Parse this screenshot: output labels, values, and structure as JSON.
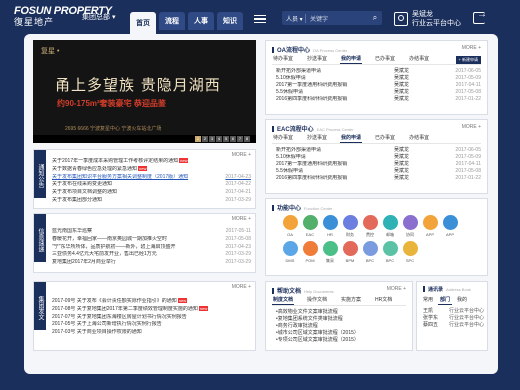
{
  "header": {
    "logo_en": "FOSUN PROPERTY",
    "logo_cn": "復星地产",
    "group_label": "集团总部 ▾",
    "nav_tabs": [
      "首页",
      "流程",
      "人事",
      "知识"
    ],
    "search": {
      "scope": "人员 ▾",
      "placeholder": "关键字"
    },
    "user": {
      "name": "吴斌龙",
      "role": "行业云平台中心"
    }
  },
  "banner": {
    "corner_text": "复星 •",
    "headline": "甬上多望族 贵隐月湖西",
    "subline": "约90-175m²奢装豪宅 恭迎品鉴",
    "footer": "2695 6666 宁波复星中心 宁波火车站北广场",
    "pages": [
      "1",
      "2",
      "3",
      "4",
      "5",
      "6",
      "7",
      "8"
    ]
  },
  "notices": {
    "tab": "通知公告",
    "more": "MORE +",
    "items": [
      {
        "t": "关于2017年一季度成本采购管理工作考核评定结果的通知",
        "d": "",
        "new": true,
        "link": false
      },
      {
        "t": "关于数据青春绿色应急处理的紧急通知",
        "d": "",
        "new": true,
        "link": false
      },
      {
        "t": "关于发布集团知识平台服务方案相关调整制度（2017版）通知",
        "d": "2017-04-23",
        "new": false,
        "link": true
      },
      {
        "t": "关于发布在线采购变更通知",
        "d": "2017-04-22",
        "new": false,
        "link": false
      },
      {
        "t": "关于发布项目文档调整的通知",
        "d": "2017-04-21",
        "new": false,
        "link": false
      },
      {
        "t": "关于发布集团部分通知",
        "d": "2017-03-29",
        "new": false,
        "link": false
      }
    ]
  },
  "info": {
    "tab": "信息速递",
    "more": "MORE +",
    "items": [
      {
        "t": "蓝光南国东华巡察",
        "d": "2017-05-11"
      },
      {
        "t": "春暖花开，幸福回家——南京奥园城一期加推火空时",
        "d": "2017-05-08"
      },
      {
        "t": "\"宁\"东华所所体，品质护航初——新外，碧上海启顶盛开",
        "d": "2017-04-23"
      },
      {
        "t": "三亚债务4.4亿元大宅前发开业，售出已经1万元",
        "d": "2017-03-29"
      },
      {
        "t": "复地集团2017年2月商业举行",
        "d": "2017-03-29"
      }
    ]
  },
  "circulars": {
    "tab": "集团发文",
    "more": "MORE +",
    "items": [
      {
        "t": "2017-09号 关于发布《会计责任额实际作业指引》的通知",
        "new": true
      },
      {
        "t": "2017-08号 关于复地集团2017年第二季度绩效管理制度实施的通知",
        "new": true
      },
      {
        "t": "2017-07号 关于复地集团东海楼区房屋计划书行情况实例报告",
        "new": false
      },
      {
        "t": "2017-05号 关于上海公司新增执行情况实例行报告",
        "new": false
      },
      {
        "t": "2017-03号 关于商业项目操作权限的通知",
        "new": false
      }
    ]
  },
  "oa": {
    "title": "OA流程中心",
    "subtitle": "OA Process Center",
    "more": "MORE +",
    "tabs": [
      "待办事宜",
      "抄送事宜",
      "我的申请",
      "已办事宜",
      "办结事宜"
    ],
    "active_tab": 2,
    "new_button": "+ 新建申请",
    "rows": [
      {
        "t": "新开拓外部渠道申请",
        "p": "吴斌龙",
        "d": "2017-06-05"
      },
      {
        "t": "5.10休假申请",
        "p": "吴斌龙",
        "d": "2017-05-09"
      },
      {
        "t": "2017第一季度通用科研费用报销",
        "p": "吴斌龙",
        "d": "2017-04-11"
      },
      {
        "t": "5.5休假申请",
        "p": "吴斌龙",
        "d": "2017-05-08"
      },
      {
        "t": "2016第四季度科研科研费用报销",
        "p": "吴斌龙",
        "d": "2017-01-22"
      }
    ]
  },
  "eac": {
    "title": "EAC流程中心",
    "subtitle": "EAC Process Center",
    "more": "MORE +",
    "tabs": [
      "待办事宜",
      "抄送事宜",
      "我的申请",
      "已办事宜",
      "办结事宜"
    ],
    "active_tab": 2,
    "rows": [
      {
        "t": "新开拓外部渠道申请",
        "p": "吴斌龙",
        "d": "2017-06-05"
      },
      {
        "t": "5.10休假申请",
        "p": "吴斌龙",
        "d": "2017-05-09"
      },
      {
        "t": "2017第一季度通用科研费用报销",
        "p": "吴斌龙",
        "d": "2017-04-11"
      },
      {
        "t": "5.5休假申请",
        "p": "吴斌龙",
        "d": "2017-05-08"
      },
      {
        "t": "2016第四季度科研科研费用报销",
        "p": "吴斌龙",
        "d": "2017-01-22"
      }
    ]
  },
  "functions": {
    "title": "功能中心",
    "subtitle": "Function Center",
    "items": [
      {
        "label": "OA",
        "color": "#f2a33a"
      },
      {
        "label": "EAC",
        "color": "#52b06b"
      },
      {
        "label": "HR",
        "color": "#3a8fd6"
      },
      {
        "label": "财务",
        "color": "#6c7ee0"
      },
      {
        "label": "费控",
        "color": "#e36a5a"
      },
      {
        "label": "邮箱",
        "color": "#2fb2b6"
      },
      {
        "label": "协同",
        "color": "#8a6fcf"
      },
      {
        "label": "APP",
        "color": "#f2a33a"
      },
      {
        "label": "APP",
        "color": "#3a8fd6"
      },
      {
        "label": "DMS",
        "color": "#5aa6e6"
      },
      {
        "label": "POM",
        "color": "#f07c3a"
      },
      {
        "label": "集采",
        "color": "#4bbf88"
      },
      {
        "label": "BPM",
        "color": "#e36a5a"
      },
      {
        "label": "BPC",
        "color": "#7a9be0"
      },
      {
        "label": "BPC",
        "color": "#5cc2a6"
      },
      {
        "label": "SPC",
        "color": "#e9b43c"
      }
    ]
  },
  "help": {
    "title": "帮助文档",
    "subtitle": "Help Documents",
    "more": "MORE +",
    "tabs": [
      "制度文档",
      "操作文档",
      "实施方案",
      "HR文档"
    ],
    "active_tab": 0,
    "items": [
      "高效物业文件文案审批流程",
      "复地集团系统文件类审批流程",
      "商务行政审批流程",
      "城市公司区域文案审批流程（2015）",
      "专项公司区域文案审批流程（2015）"
    ]
  },
  "contacts": {
    "title": "通讯录",
    "subtitle": "Address Book",
    "tabs": [
      "常用",
      "部门",
      "我的"
    ],
    "active_tab": 1,
    "items": [
      {
        "n": "王凯",
        "o": "行业云平台中心"
      },
      {
        "n": "张学东",
        "o": "行业云平台中心"
      },
      {
        "n": "蔡四五",
        "o": "行业云平台中心"
      }
    ]
  }
}
